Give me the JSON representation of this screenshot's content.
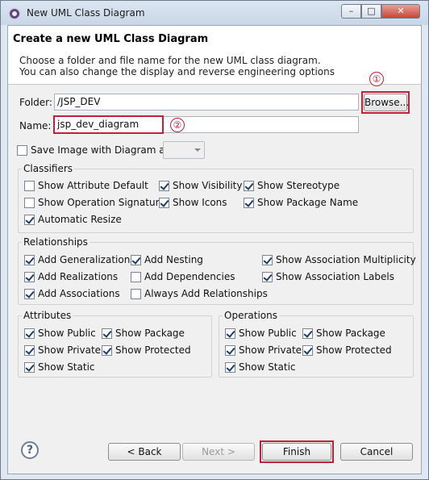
{
  "window": {
    "title": "New UML Class Diagram",
    "min_glyph": "–",
    "max_glyph": "□",
    "close_glyph": "✕"
  },
  "header": {
    "title": "Create a new UML Class Diagram",
    "desc_line1": "Choose a folder and file name for the new UML class diagram.",
    "desc_line2": "You can also change the display and reverse engineering options"
  },
  "form": {
    "folder_label": "Folder:",
    "folder_value": "/JSP_DEV",
    "browse_label": "Browse...",
    "name_label": "Name:",
    "name_value": "jsp_dev_diagram",
    "save_image_label": "Save Image with Diagram as",
    "callout1": "①",
    "callout2": "②"
  },
  "classifiers": {
    "title": "Classifiers",
    "items": [
      {
        "label": "Show Attribute Default",
        "checked": false
      },
      {
        "label": "Show Visibility",
        "checked": true
      },
      {
        "label": "Show Stereotype",
        "checked": true
      },
      {
        "label": "Show Operation Signature",
        "checked": false
      },
      {
        "label": "Show Icons",
        "checked": true
      },
      {
        "label": "Show Package Name",
        "checked": true
      },
      {
        "label": "Automatic Resize",
        "checked": true
      }
    ]
  },
  "relationships": {
    "title": "Relationships",
    "items": [
      {
        "label": "Add Generalizations",
        "checked": true
      },
      {
        "label": "Add Nesting",
        "checked": true
      },
      {
        "label": "Show Association Multiplicity",
        "checked": true
      },
      {
        "label": "Add Realizations",
        "checked": true
      },
      {
        "label": "Add Dependencies",
        "checked": false
      },
      {
        "label": "Show Association Labels",
        "checked": true
      },
      {
        "label": "Add Associations",
        "checked": true
      },
      {
        "label": "Always Add Relationships",
        "checked": false
      }
    ]
  },
  "attributes": {
    "title": "Attributes",
    "items": [
      {
        "label": "Show Public",
        "checked": true
      },
      {
        "label": "Show Package",
        "checked": true
      },
      {
        "label": "Show Private",
        "checked": true
      },
      {
        "label": "Show Protected",
        "checked": true
      },
      {
        "label": "Show Static",
        "checked": true
      }
    ]
  },
  "operations": {
    "title": "Operations",
    "items": [
      {
        "label": "Show Public",
        "checked": true
      },
      {
        "label": "Show Package",
        "checked": true
      },
      {
        "label": "Show Private",
        "checked": true
      },
      {
        "label": "Show Protected",
        "checked": true
      },
      {
        "label": "Show Static",
        "checked": true
      }
    ]
  },
  "footer": {
    "help_glyph": "?",
    "back_label": "< Back",
    "next_label": "Next >",
    "finish_label": "Finish",
    "cancel_label": "Cancel"
  },
  "colors": {
    "highlight": "#c0203a",
    "accent": "#1d3b6b"
  }
}
